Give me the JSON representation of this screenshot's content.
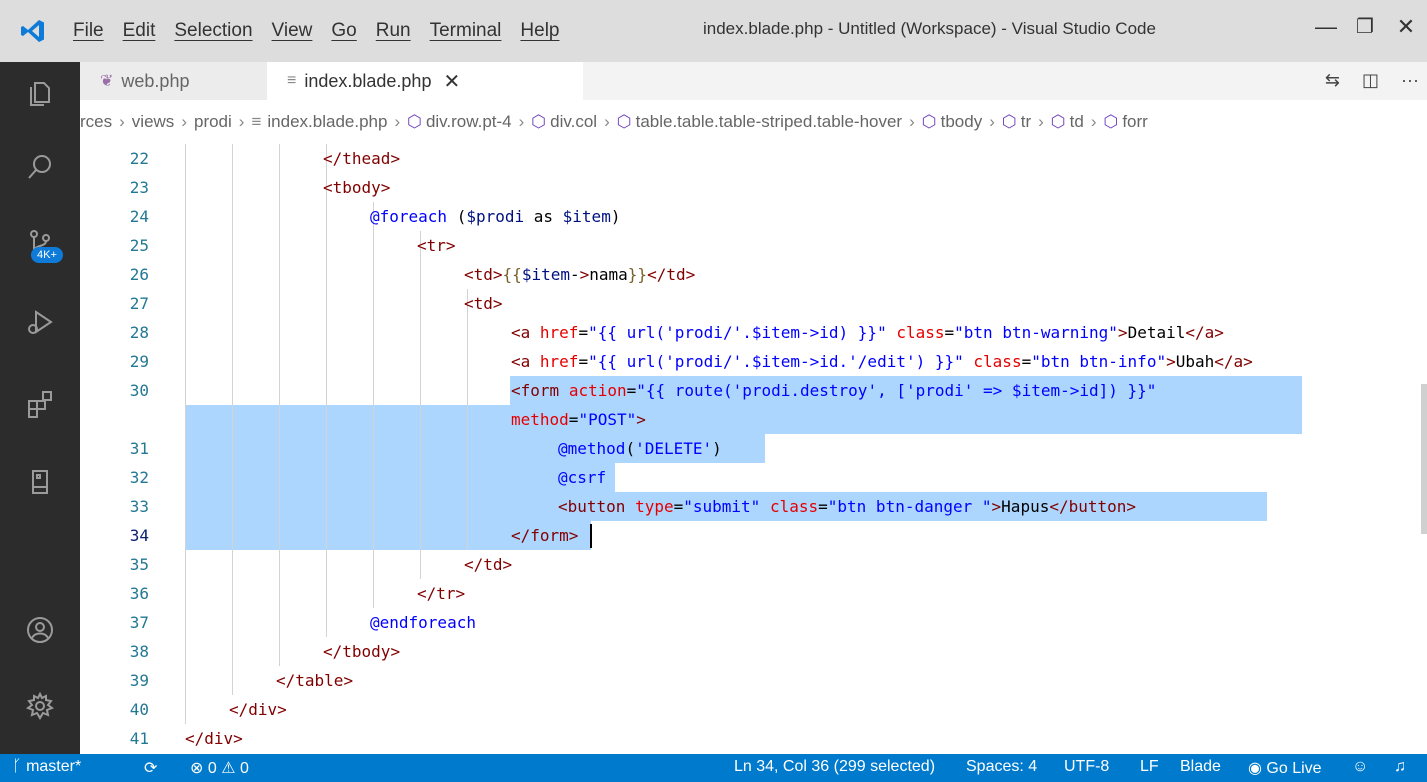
{
  "window": {
    "title": "index.blade.php - Untitled (Workspace) - Visual Studio Code",
    "menu": [
      "File",
      "Edit",
      "Selection",
      "View",
      "Go",
      "Run",
      "Terminal",
      "Help"
    ],
    "controls": {
      "minimize": "—",
      "restore": "❐",
      "close": "✕"
    }
  },
  "activity": {
    "items": [
      "explorer-icon",
      "search-icon",
      "source-control-icon",
      "run-debug-icon",
      "extensions-icon",
      "remote-explorer-icon",
      "accounts-icon",
      "settings-gear-icon"
    ],
    "badge": "4K+"
  },
  "tabs": [
    {
      "label": "web.php",
      "icon": "php-elephant-icon",
      "active": false
    },
    {
      "label": "index.blade.php",
      "icon": "blade-file-icon",
      "active": true,
      "close": "✕"
    }
  ],
  "tab_actions": [
    "compare-changes-icon",
    "split-editor-icon",
    "more-actions-icon"
  ],
  "breadcrumb": [
    "rces",
    "views",
    "prodi",
    "index.blade.php",
    "div.row.pt-4",
    "div.col",
    "table.table.table-striped.table-hover",
    "tbody",
    "tr",
    "td",
    "forr"
  ],
  "editor": {
    "lines": [
      {
        "n": "22",
        "text": "</thead>"
      },
      {
        "n": "23",
        "text": "<tbody>"
      },
      {
        "n": "24",
        "text": "@foreach ($prodi as $item)"
      },
      {
        "n": "25",
        "text": "<tr>"
      },
      {
        "n": "26",
        "text": "<td>{{$item->nama}}</td>"
      },
      {
        "n": "27",
        "text": "<td>"
      },
      {
        "n": "28",
        "text": "<a href=\"{{ url('prodi/'.$item->id) }}\" class=\"btn btn-warning\">Detail</a>"
      },
      {
        "n": "29",
        "text": "<a href=\"{{ url('prodi/'.$item->id.'/edit') }}\" class=\"btn btn-info\">Ubah</a>"
      },
      {
        "n": "30",
        "text": "<form action=\"{{ route('prodi.destroy', ['prodi' => $item->id]) }}\""
      },
      {
        "n": "",
        "text": "method=\"POST\">"
      },
      {
        "n": "31",
        "text": "@method('DELETE')"
      },
      {
        "n": "32",
        "text": "@csrf"
      },
      {
        "n": "33",
        "text": "<button type=\"submit\" class=\"btn btn-danger \">Hapus</button>"
      },
      {
        "n": "34",
        "text": "</form>"
      },
      {
        "n": "35",
        "text": "</td>"
      },
      {
        "n": "36",
        "text": "</tr>"
      },
      {
        "n": "37",
        "text": "@endforeach"
      },
      {
        "n": "38",
        "text": "</tbody>"
      },
      {
        "n": "39",
        "text": "</table>"
      },
      {
        "n": "40",
        "text": "</div>"
      },
      {
        "n": "41",
        "text": "</div>"
      }
    ],
    "current_line": "34"
  },
  "status": {
    "branch": "master*",
    "sync_icon": "sync-icon",
    "errors": "0",
    "warnings": "0",
    "position": "Ln 34, Col 36 (299 selected)",
    "spaces": "Spaces: 4",
    "encoding": "UTF-8",
    "eol": "LF",
    "language": "Blade",
    "golive": "Go Live",
    "feedback_icon": "feedback-icon",
    "bell_icon": "bell-icon"
  },
  "colors": {
    "accent": "#007acc",
    "selection": "#add6ff",
    "activity_bg": "#2c2c2c",
    "title_bg": "#dddddd"
  }
}
